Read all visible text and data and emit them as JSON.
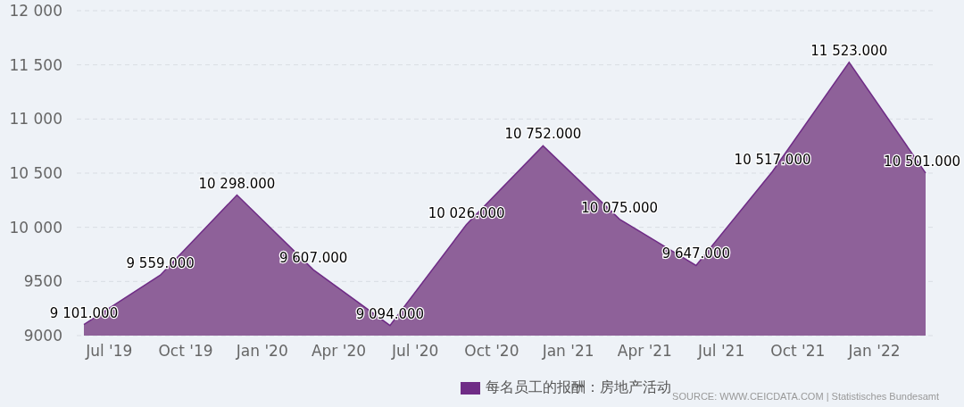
{
  "chart_data": {
    "type": "area",
    "ylim": [
      9000,
      12000
    ],
    "yticks": [
      {
        "value": 9000,
        "label": "9000"
      },
      {
        "value": 9500,
        "label": "9500"
      },
      {
        "value": 10000,
        "label": "10 000"
      },
      {
        "value": 10500,
        "label": "10 500"
      },
      {
        "value": 11000,
        "label": "11 000"
      },
      {
        "value": 11500,
        "label": "11 500"
      },
      {
        "value": 12000,
        "label": "12 000"
      }
    ],
    "categories": [
      "Jul '19",
      "Oct '19",
      "Jan '20",
      "Apr '20",
      "Jul '20",
      "Oct '20",
      "Jan '21",
      "Apr '21",
      "Jul '21",
      "Oct '21",
      "Jan '22",
      null
    ],
    "series": [
      {
        "name": "每名员工的报酬：房地产活动",
        "color": "#6f2c86",
        "values": [
          9101,
          9559,
          10298,
          9607,
          9094,
          10026,
          10752,
          10075,
          9647,
          10517,
          11523,
          10501
        ]
      }
    ],
    "grid": true,
    "value_labels": [
      "9 101.000",
      "9 559.000",
      "10 298.000",
      "9 607.000",
      "9 094.000",
      "10 026.000",
      "10 752.000",
      "10 075.000",
      "9 647.000",
      "10 517.000",
      "11 523.000",
      "10 501.000"
    ]
  },
  "source": "SOURCE: WWW.CEICDATA.COM | Statistisches Bundesamt"
}
